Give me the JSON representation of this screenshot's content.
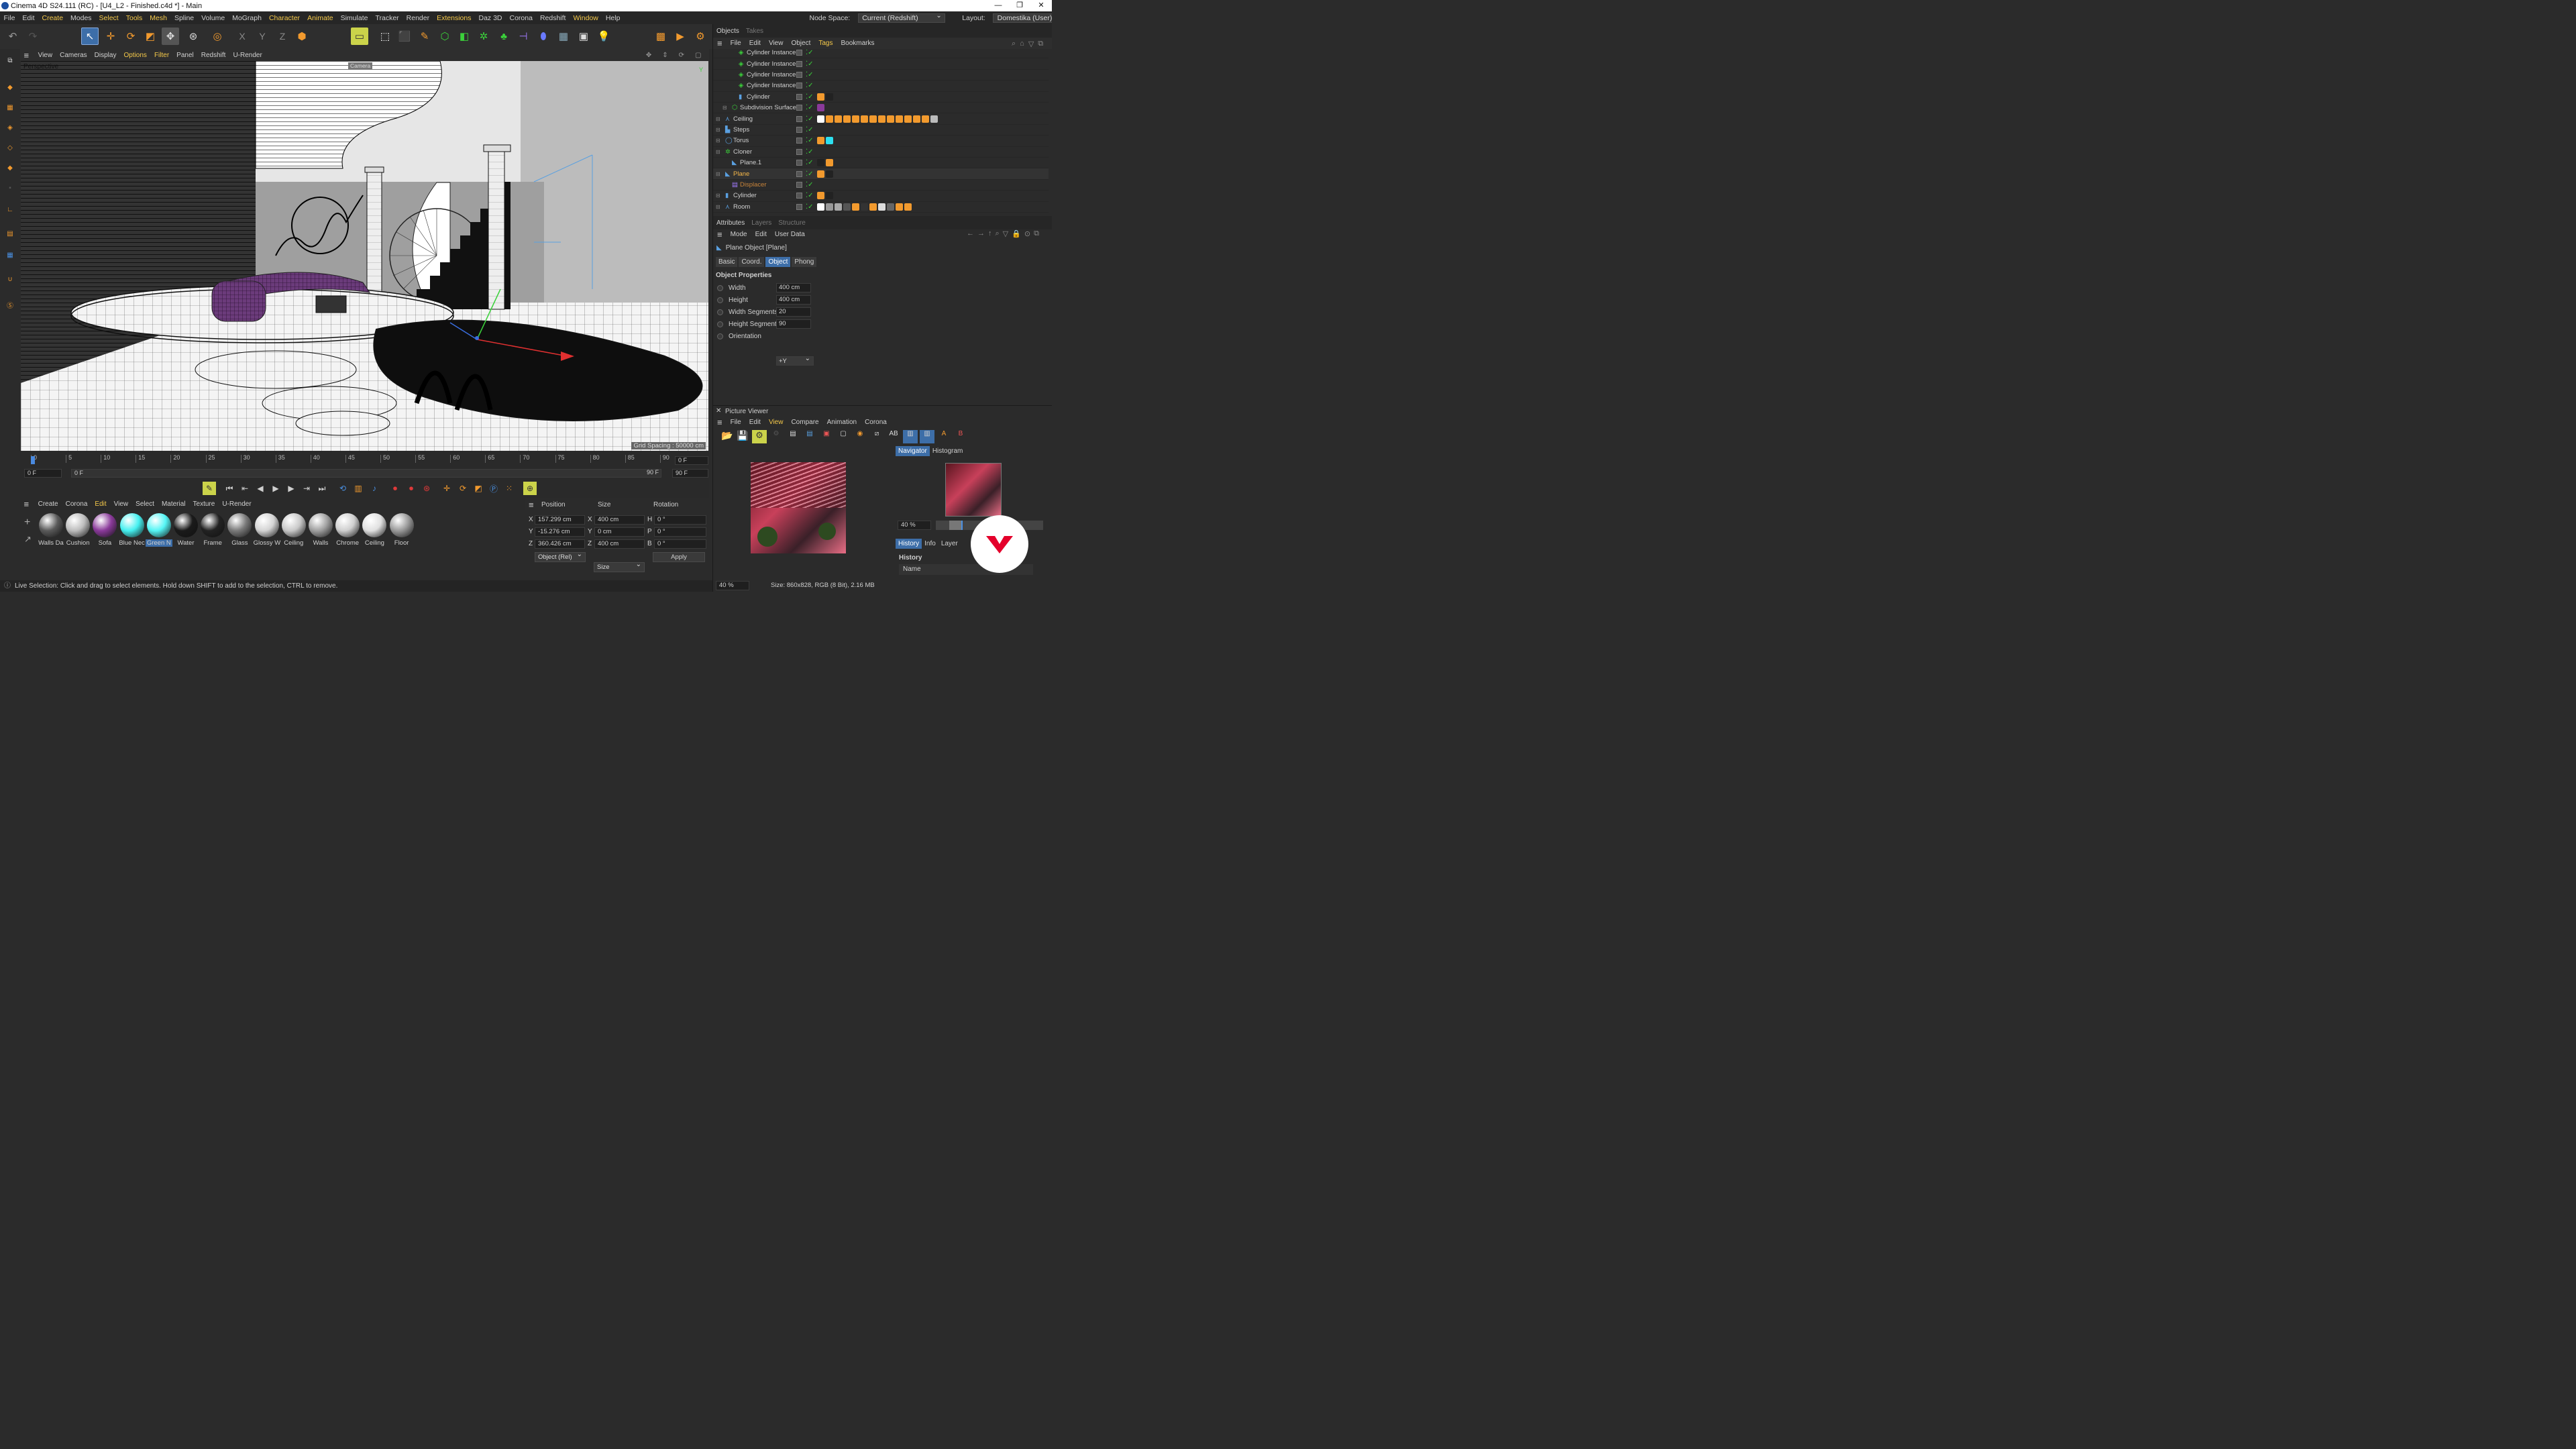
{
  "window": {
    "title": "Cinema 4D S24.111 (RC) - [U4_L2 - Finished.c4d *] - Main",
    "min": "—",
    "max": "❐",
    "close": "✕"
  },
  "menu": {
    "items": [
      "File",
      "Edit",
      "Create",
      "Modes",
      "Select",
      "Tools",
      "Mesh",
      "Spline",
      "Volume",
      "MoGraph",
      "Character",
      "Animate",
      "Simulate",
      "Tracker",
      "Render",
      "Extensions",
      "Daz 3D",
      "Corona",
      "Redshift",
      "Window",
      "Help"
    ],
    "highlighted": [
      "Create",
      "Select",
      "Tools",
      "Mesh",
      "Character",
      "Animate",
      "Extensions",
      "Window"
    ],
    "node_space_label": "Node Space:",
    "node_space_value": "Current (Redshift)",
    "layout_label": "Layout:",
    "layout_value": "Domestika (User)"
  },
  "viewport": {
    "menu": [
      "View",
      "Cameras",
      "Display",
      "Options",
      "Filter",
      "Panel",
      "Redshift",
      "U-Render"
    ],
    "highlighted": [
      "Options",
      "Filter"
    ],
    "label": "Perspective",
    "camera": "Camera",
    "grid": "Grid Spacing : 50000 cm"
  },
  "timeline": {
    "ticks": [
      "0",
      "5",
      "10",
      "15",
      "20",
      "25",
      "30",
      "35",
      "40",
      "45",
      "50",
      "55",
      "60",
      "65",
      "70",
      "75",
      "80",
      "85",
      "90"
    ],
    "current": "0 F",
    "start": "0 F",
    "start2": "0 F",
    "end": "90 F",
    "end2": "90 F"
  },
  "materials": {
    "menu": [
      "Create",
      "Corona",
      "Edit",
      "View",
      "Select",
      "Material",
      "Texture",
      "U-Render"
    ],
    "highlighted": [
      "Edit"
    ],
    "items": [
      {
        "name": "Walls Da",
        "color": "#5a5a5a"
      },
      {
        "name": "Cushion",
        "color": "#bdbdbd"
      },
      {
        "name": "Sofa",
        "color": "#8a3a9a"
      },
      {
        "name": "Blue Nec",
        "color": "#45f0f0"
      },
      {
        "name": "Green N",
        "color": "#55f5f5"
      },
      {
        "name": "Water",
        "color": "#1a1a1a"
      },
      {
        "name": "Frame",
        "color": "#222"
      },
      {
        "name": "Glass",
        "color": "#7a7a7a"
      },
      {
        "name": "Glossy W",
        "color": "#d4d4d4"
      },
      {
        "name": "Ceiling",
        "color": "#c8c8c8"
      },
      {
        "name": "Walls",
        "color": "#a0a0a0"
      },
      {
        "name": "Chrome",
        "color": "#cfcfcf"
      },
      {
        "name": "Ceiling",
        "color": "#e0e0e0"
      },
      {
        "name": "Floor",
        "color": "#9a9a9a"
      }
    ]
  },
  "coords": {
    "h_position": "Position",
    "h_size": "Size",
    "h_rotation": "Rotation",
    "x": "157.299 cm",
    "y": "-15.276 cm",
    "z": "360.426 cm",
    "sx": "400 cm",
    "sy": "0 cm",
    "sz": "400 cm",
    "h": "0 °",
    "p": "0 °",
    "b": "0 °",
    "lx": "X",
    "ly": "Y",
    "lz": "Z",
    "lh": "H",
    "lp": "P",
    "lb": "B",
    "mode": "Object (Rel)",
    "size_mode": "Size",
    "apply": "Apply"
  },
  "status": "Live Selection: Click and drag to select elements. Hold down SHIFT to add to the selection, CTRL to remove.",
  "objects": {
    "tabs": [
      "Objects",
      "Takes"
    ],
    "menu": [
      "File",
      "Edit",
      "View",
      "Object",
      "Tags",
      "Bookmarks"
    ],
    "rows": [
      {
        "name": "Cylinder Instance.3",
        "indent": 2,
        "color": "#d0d0d0"
      },
      {
        "name": "Cylinder Instance.2",
        "indent": 2,
        "color": "#d0d0d0"
      },
      {
        "name": "Cylinder Instance.1",
        "indent": 2,
        "color": "#d0d0d0"
      },
      {
        "name": "Cylinder Instance",
        "indent": 2,
        "color": "#d0d0d0"
      },
      {
        "name": "Cylinder",
        "indent": 2,
        "color": "#d0d0d0"
      },
      {
        "name": "Subdivision Surface",
        "indent": 1,
        "color": "#d0d0d0"
      },
      {
        "name": "Ceiling",
        "indent": 0,
        "color": "#d0d0d0"
      },
      {
        "name": "Steps",
        "indent": 0,
        "color": "#d0d0d0"
      },
      {
        "name": "Torus",
        "indent": 0,
        "color": "#d0d0d0"
      },
      {
        "name": "Cloner",
        "indent": 0,
        "color": "#d0d0d0"
      },
      {
        "name": "Plane.1",
        "indent": 1,
        "color": "#d0d0d0"
      },
      {
        "name": "Plane",
        "indent": 0,
        "color": "#f5b74a"
      },
      {
        "name": "Displacer",
        "indent": 1,
        "color": "#c9843a"
      },
      {
        "name": "Cylinder",
        "indent": 0,
        "color": "#d0d0d0"
      },
      {
        "name": "Room",
        "indent": 0,
        "color": "#d0d0d0"
      }
    ]
  },
  "attributes": {
    "tabs": [
      "Attributes",
      "Layers",
      "Structure"
    ],
    "menu": [
      "Mode",
      "Edit",
      "User Data"
    ],
    "object": "Plane Object [Plane]",
    "subtabs": [
      "Basic",
      "Coord.",
      "Object",
      "Phong"
    ],
    "active_subtab": "Object",
    "section": "Object Properties",
    "props": [
      {
        "label": "Width",
        "value": "400 cm"
      },
      {
        "label": "Height",
        "value": "400 cm"
      },
      {
        "label": "Width Segments",
        "value": "20"
      },
      {
        "label": "Height Segments",
        "value": "90"
      },
      {
        "label": "Orientation",
        "value": "+Y"
      }
    ]
  },
  "picture_viewer": {
    "title": "Picture Viewer",
    "menu": [
      "File",
      "Edit",
      "View",
      "Compare",
      "Animation",
      "Corona"
    ],
    "highlighted": [
      "View"
    ],
    "nav_tabs": [
      "Navigator",
      "Histogram"
    ],
    "zoom": "40 %",
    "hist_tabs": [
      "History",
      "Info",
      "Layer"
    ],
    "history_label": "History",
    "name_col": "Name",
    "footer_zoom": "40 %",
    "size_info": "Size: 860x828, RGB (8 Bit), 2.16 MB"
  }
}
